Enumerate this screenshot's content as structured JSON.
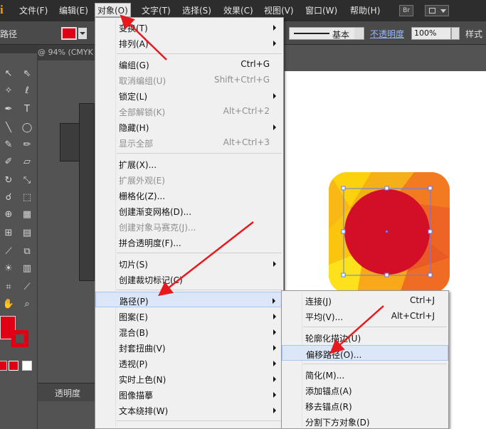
{
  "app": {
    "logo": "Ai"
  },
  "menubar": {
    "items": [
      {
        "label": "文件(F)"
      },
      {
        "label": "编辑(E)"
      },
      {
        "label": "对象(O)"
      },
      {
        "label": "文字(T)"
      },
      {
        "label": "选择(S)"
      },
      {
        "label": "效果(C)"
      },
      {
        "label": "视图(V)"
      },
      {
        "label": "窗口(W)"
      },
      {
        "label": "帮助(H)"
      }
    ],
    "bridge_label": "Br"
  },
  "controlbar": {
    "selection_label": "路径",
    "stroke_profile": "基本",
    "opacity_label": "不透明度",
    "opacity_value": "100%",
    "style_label": "样式"
  },
  "document": {
    "tab_label": "@ 94% (CMYK"
  },
  "panels": {
    "transparency_label": "透明度"
  },
  "object_menu": {
    "items": [
      {
        "label": "变换(T)",
        "shortcut": "",
        "submenu": true,
        "disabled": false
      },
      {
        "label": "排列(A)",
        "shortcut": "",
        "submenu": true,
        "disabled": false
      },
      {
        "label": "编组(G)",
        "shortcut": "Ctrl+G",
        "submenu": false,
        "disabled": false
      },
      {
        "label": "取消编组(U)",
        "shortcut": "Shift+Ctrl+G",
        "submenu": false,
        "disabled": true
      },
      {
        "label": "锁定(L)",
        "shortcut": "",
        "submenu": true,
        "disabled": false
      },
      {
        "label": "全部解锁(K)",
        "shortcut": "Alt+Ctrl+2",
        "submenu": false,
        "disabled": true
      },
      {
        "label": "隐藏(H)",
        "shortcut": "",
        "submenu": true,
        "disabled": false
      },
      {
        "label": "显示全部",
        "shortcut": "Alt+Ctrl+3",
        "submenu": false,
        "disabled": true
      },
      {
        "label": "扩展(X)...",
        "shortcut": "",
        "submenu": false,
        "disabled": false
      },
      {
        "label": "扩展外观(E)",
        "shortcut": "",
        "submenu": false,
        "disabled": true
      },
      {
        "label": "栅格化(Z)...",
        "shortcut": "",
        "submenu": false,
        "disabled": false
      },
      {
        "label": "创建渐变网格(D)...",
        "shortcut": "",
        "submenu": false,
        "disabled": false
      },
      {
        "label": "创建对象马赛克(J)...",
        "shortcut": "",
        "submenu": false,
        "disabled": true
      },
      {
        "label": "拼合透明度(F)...",
        "shortcut": "",
        "submenu": false,
        "disabled": false
      },
      {
        "label": "切片(S)",
        "shortcut": "",
        "submenu": true,
        "disabled": false
      },
      {
        "label": "创建裁切标记(C)",
        "shortcut": "",
        "submenu": false,
        "disabled": false
      },
      {
        "label": "路径(P)",
        "shortcut": "",
        "submenu": true,
        "disabled": false
      },
      {
        "label": "图案(E)",
        "shortcut": "",
        "submenu": true,
        "disabled": false
      },
      {
        "label": "混合(B)",
        "shortcut": "",
        "submenu": true,
        "disabled": false
      },
      {
        "label": "封套扭曲(V)",
        "shortcut": "",
        "submenu": true,
        "disabled": false
      },
      {
        "label": "透视(P)",
        "shortcut": "",
        "submenu": true,
        "disabled": false
      },
      {
        "label": "实时上色(N)",
        "shortcut": "",
        "submenu": true,
        "disabled": false
      },
      {
        "label": "图像描摹",
        "shortcut": "",
        "submenu": true,
        "disabled": false
      },
      {
        "label": "文本绕排(W)",
        "shortcut": "",
        "submenu": true,
        "disabled": false
      }
    ]
  },
  "path_menu": {
    "items": [
      {
        "label": "连接(J)",
        "shortcut": "Ctrl+J"
      },
      {
        "label": "平均(V)...",
        "shortcut": "Alt+Ctrl+J"
      },
      {
        "label": "轮廓化描边(U)",
        "shortcut": ""
      },
      {
        "label": "偏移路径(O)...",
        "shortcut": ""
      },
      {
        "label": "简化(M)...",
        "shortcut": ""
      },
      {
        "label": "添加锚点(A)",
        "shortcut": ""
      },
      {
        "label": "移去锚点(R)",
        "shortcut": ""
      },
      {
        "label": "分割下方对象(D)",
        "shortcut": ""
      }
    ]
  },
  "colors": {
    "accent_red": "#e00016",
    "menu_bg": "#f0f0f0",
    "highlight": "#dbe7f8",
    "annotation_arrow": "#e8191e"
  }
}
